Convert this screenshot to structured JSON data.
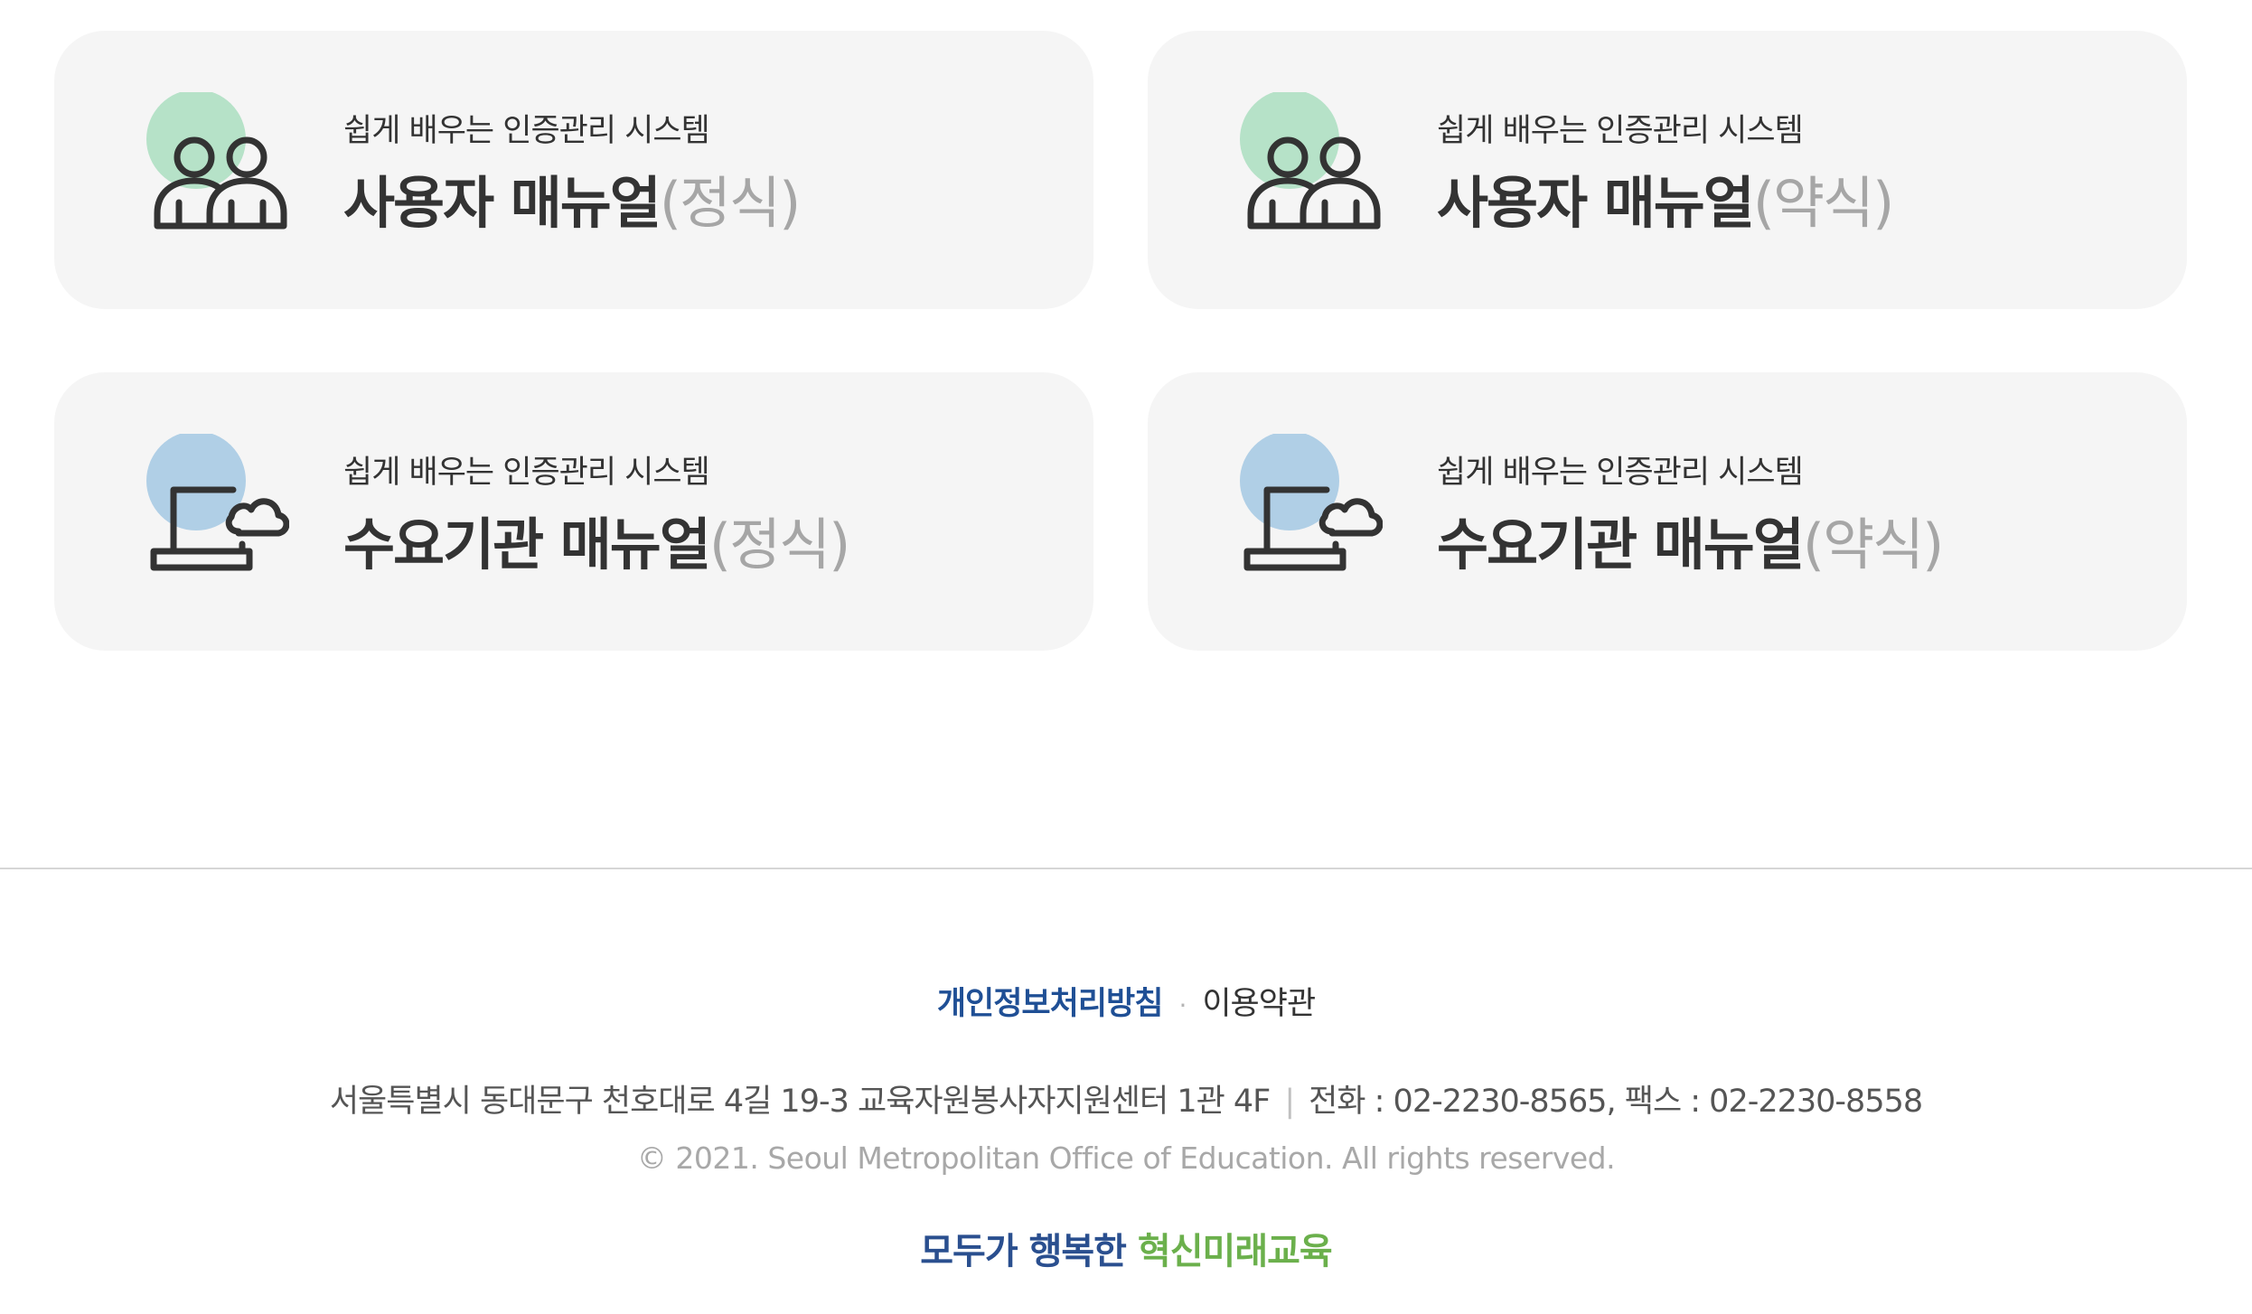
{
  "colors": {
    "card_background": "#f5f5f5",
    "text_main": "#333333",
    "text_suffix": "#a6a6a6",
    "accent_green_circle": "#b6e2c8",
    "accent_blue_circle": "#b0cfe6",
    "link_blue": "#1f4f95",
    "slogan_blue": "#2a4f8f",
    "slogan_green": "#6bb04c"
  },
  "cards": [
    {
      "icon": "people-icon",
      "subtitle": "쉽게 배우는 인증관리 시스템",
      "title": "사용자 매뉴얼",
      "suffix": "(정식)"
    },
    {
      "icon": "people-icon",
      "subtitle": "쉽게 배우는 인증관리 시스템",
      "title": "사용자 매뉴얼",
      "suffix": "(약식)"
    },
    {
      "icon": "laptop-cloud-icon",
      "subtitle": "쉽게 배우는 인증관리 시스템",
      "title": "수요기관 매뉴얼",
      "suffix": "(정식)"
    },
    {
      "icon": "laptop-cloud-icon",
      "subtitle": "쉽게 배우는 인증관리 시스템",
      "title": "수요기관 매뉴얼",
      "suffix": "(약식)"
    }
  ],
  "footer": {
    "privacy_link": "개인정보처리방침",
    "separator_dot": "·",
    "terms_link": "이용약관",
    "address": "서울특별시 동대문구 천호대로 4길 19-3 교육자원봉사자지원센터 1관 4F",
    "address_separator": "|",
    "contact": "전화 : 02-2230-8565, 팩스 : 02-2230-8558",
    "copyright": "© 2021. Seoul Metropolitan Office of Education. All rights reserved.",
    "slogan_part1": "모두가 행복한",
    "slogan_part2": "혁신미래교육"
  }
}
